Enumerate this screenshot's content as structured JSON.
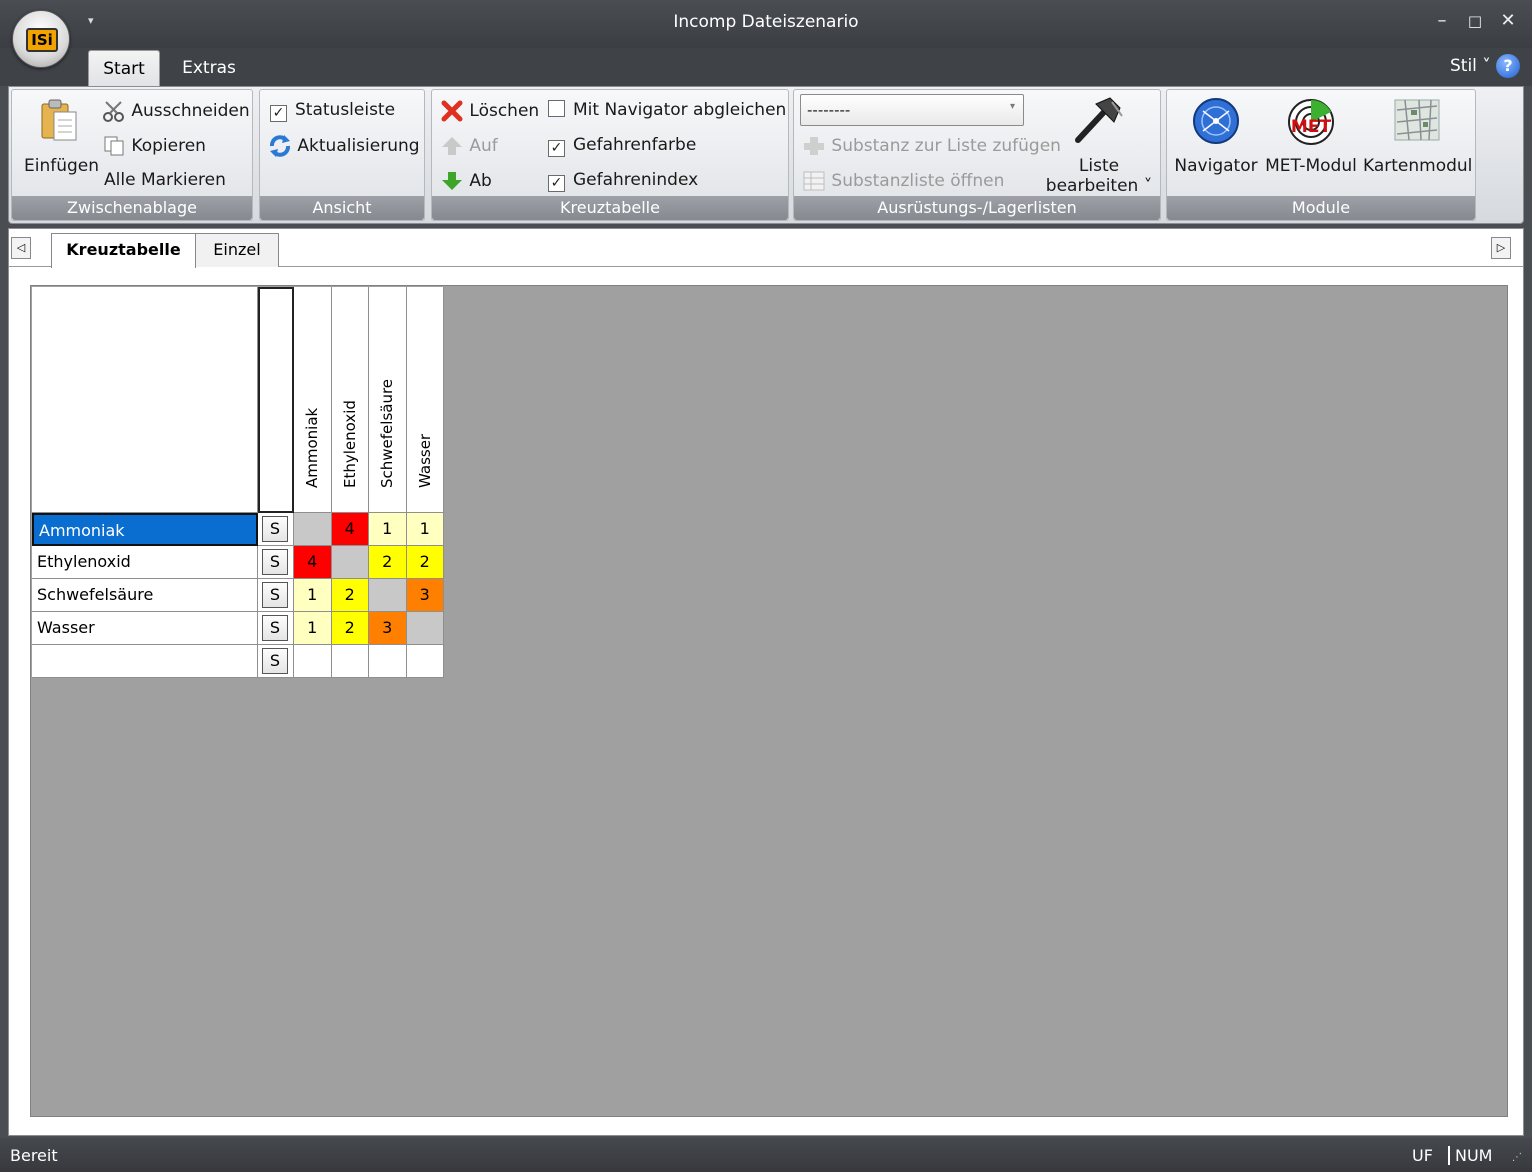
{
  "window": {
    "title": "Incomp Dateiszenario",
    "logo_text": "ISi",
    "minimize": "–",
    "maximize": "□",
    "close": "✕"
  },
  "ribbon_tabs": {
    "start": "Start",
    "extras": "Extras",
    "stil": "Stil ˅",
    "help": "?"
  },
  "groups": {
    "zwischenablage": {
      "label": "Zwischenablage",
      "einfuegen": "Einfügen",
      "ausschneiden": "Ausschneiden",
      "kopieren": "Kopieren",
      "alle_markieren": "Alle Markieren"
    },
    "ansicht": {
      "label": "Ansicht",
      "statusleiste": "Statusleiste",
      "aktualisierung": "Aktualisierung"
    },
    "kreuztabelle": {
      "label": "Kreuztabelle",
      "loeschen": "Löschen",
      "auf": "Auf",
      "ab": "Ab",
      "mit_navigator": "Mit Navigator abgleichen",
      "gefahrenfarbe": "Gefahrenfarbe",
      "gefahrenindex": "Gefahrenindex"
    },
    "listen": {
      "label": "Ausrüstungs-/Lagerlisten",
      "combo_value": "--------",
      "substanz_zufuegen": "Substanz zur Liste zufügen",
      "substanzliste_oeffnen": "Substanzliste öffnen",
      "liste": "Liste",
      "bearbeiten": "bearbeiten ˅"
    },
    "module": {
      "label": "Module",
      "navigator": "Navigator",
      "met": "MET-Modul",
      "karten": "Kartenmodul",
      "met_logo": "MET"
    }
  },
  "checkboxes": {
    "statusleiste": true,
    "mit_navigator": false,
    "gefahrenfarbe": true,
    "gefahrenindex": true
  },
  "doc_tabs": {
    "kreuztabelle": "Kreuztabelle",
    "einzel": "Einzel"
  },
  "table": {
    "columns": [
      "Ammoniak",
      "Ethylenoxid",
      "Schwefelsäure",
      "Wasser"
    ],
    "rows": [
      "Ammoniak",
      "Ethylenoxid",
      "Schwefelsäure",
      "Wasser",
      ""
    ],
    "s_label": "S",
    "values": [
      [
        "",
        "4",
        "1",
        "1"
      ],
      [
        "4",
        "",
        "2",
        "2"
      ],
      [
        "1",
        "2",
        "",
        "3"
      ],
      [
        "1",
        "2",
        "3",
        ""
      ],
      [
        "",
        "",
        "",
        ""
      ]
    ],
    "hazard_colors": {
      "1": "#ffffc0",
      "2": "#ffff00",
      "3": "#ff8000",
      "4": "#ff0000",
      "diagonal": "#c8c8c8",
      "empty": "#ffffff"
    },
    "selected_row_color": "#0a6ed1"
  },
  "status": {
    "text": "Bereit",
    "uf": "UF",
    "num": "NUM"
  }
}
